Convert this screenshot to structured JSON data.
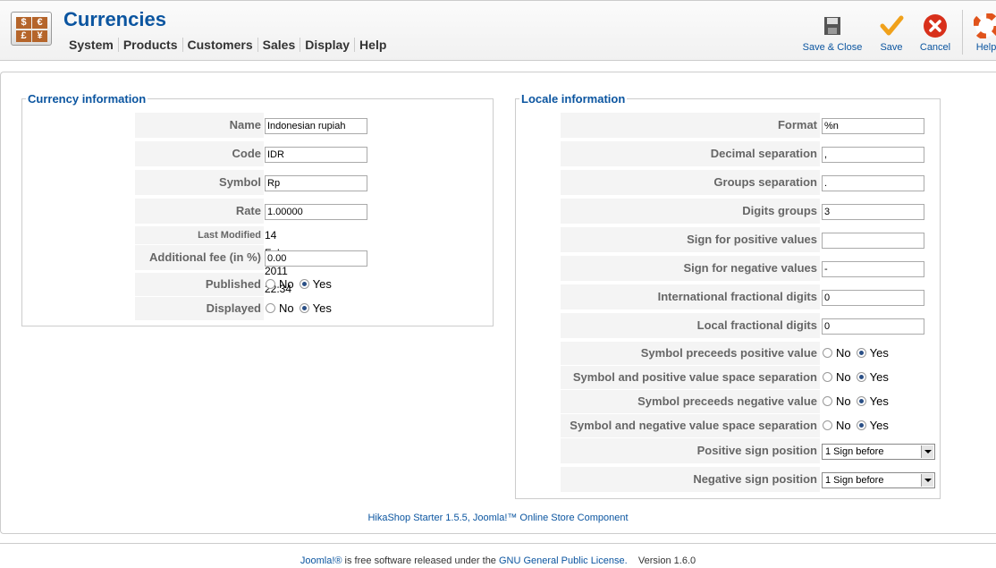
{
  "header": {
    "title": "Currencies",
    "menu": [
      "System",
      "Products",
      "Customers",
      "Sales",
      "Display",
      "Help"
    ],
    "logo_glyphs": [
      "$",
      "€",
      "£",
      "¥"
    ],
    "toolbar": {
      "save_close": "Save & Close",
      "save": "Save",
      "cancel": "Cancel",
      "help": "Help"
    }
  },
  "currency": {
    "legend": "Currency information",
    "name_label": "Name",
    "name_value": "Indonesian rupiah",
    "code_label": "Code",
    "code_value": "IDR",
    "symbol_label": "Symbol",
    "symbol_value": "Rp",
    "rate_label": "Rate",
    "rate_value": "1.00000",
    "modified_label": "Last Modified",
    "modified_value": "14 February 2011 22:34",
    "fee_label": "Additional fee (in %)",
    "fee_value": "0.00",
    "published_label": "Published",
    "displayed_label": "Displayed"
  },
  "radio": {
    "no": "No",
    "yes": "Yes"
  },
  "locale": {
    "legend": "Locale information",
    "format_label": "Format",
    "format_value": "%n",
    "decimal_label": "Decimal separation",
    "decimal_value": ",",
    "groups_label": "Groups separation",
    "groups_value": ".",
    "digits_label": "Digits groups",
    "digits_value": "3",
    "pos_sign_label": "Sign for positive values",
    "pos_sign_value": "",
    "neg_sign_label": "Sign for negative values",
    "neg_sign_value": "-",
    "intl_frac_label": "International fractional digits",
    "intl_frac_value": "0",
    "local_frac_label": "Local fractional digits",
    "local_frac_value": "0",
    "sym_pre_pos_label": "Symbol preceeds positive value",
    "sym_sp_pos_label": "Symbol and positive value space separation",
    "sym_pre_neg_label": "Symbol preceeds negative value",
    "sym_sp_neg_label": "Symbol and negative value space separation",
    "pos_pos_label": "Positive sign position",
    "pos_pos_value": "1 Sign before",
    "neg_pos_label": "Negative sign position",
    "neg_pos_value": "1 Sign before"
  },
  "credit": "HikaShop Starter 1.5.5, Joomla!™ Online Store Component",
  "footer": {
    "joomla": "Joomla!®",
    "text": " is free software released under the ",
    "license": "GNU General Public License.",
    "version": "Version 1.6.0"
  },
  "colors": {
    "accent": "#0b55a0",
    "label_bg": "#f4f4f4"
  }
}
